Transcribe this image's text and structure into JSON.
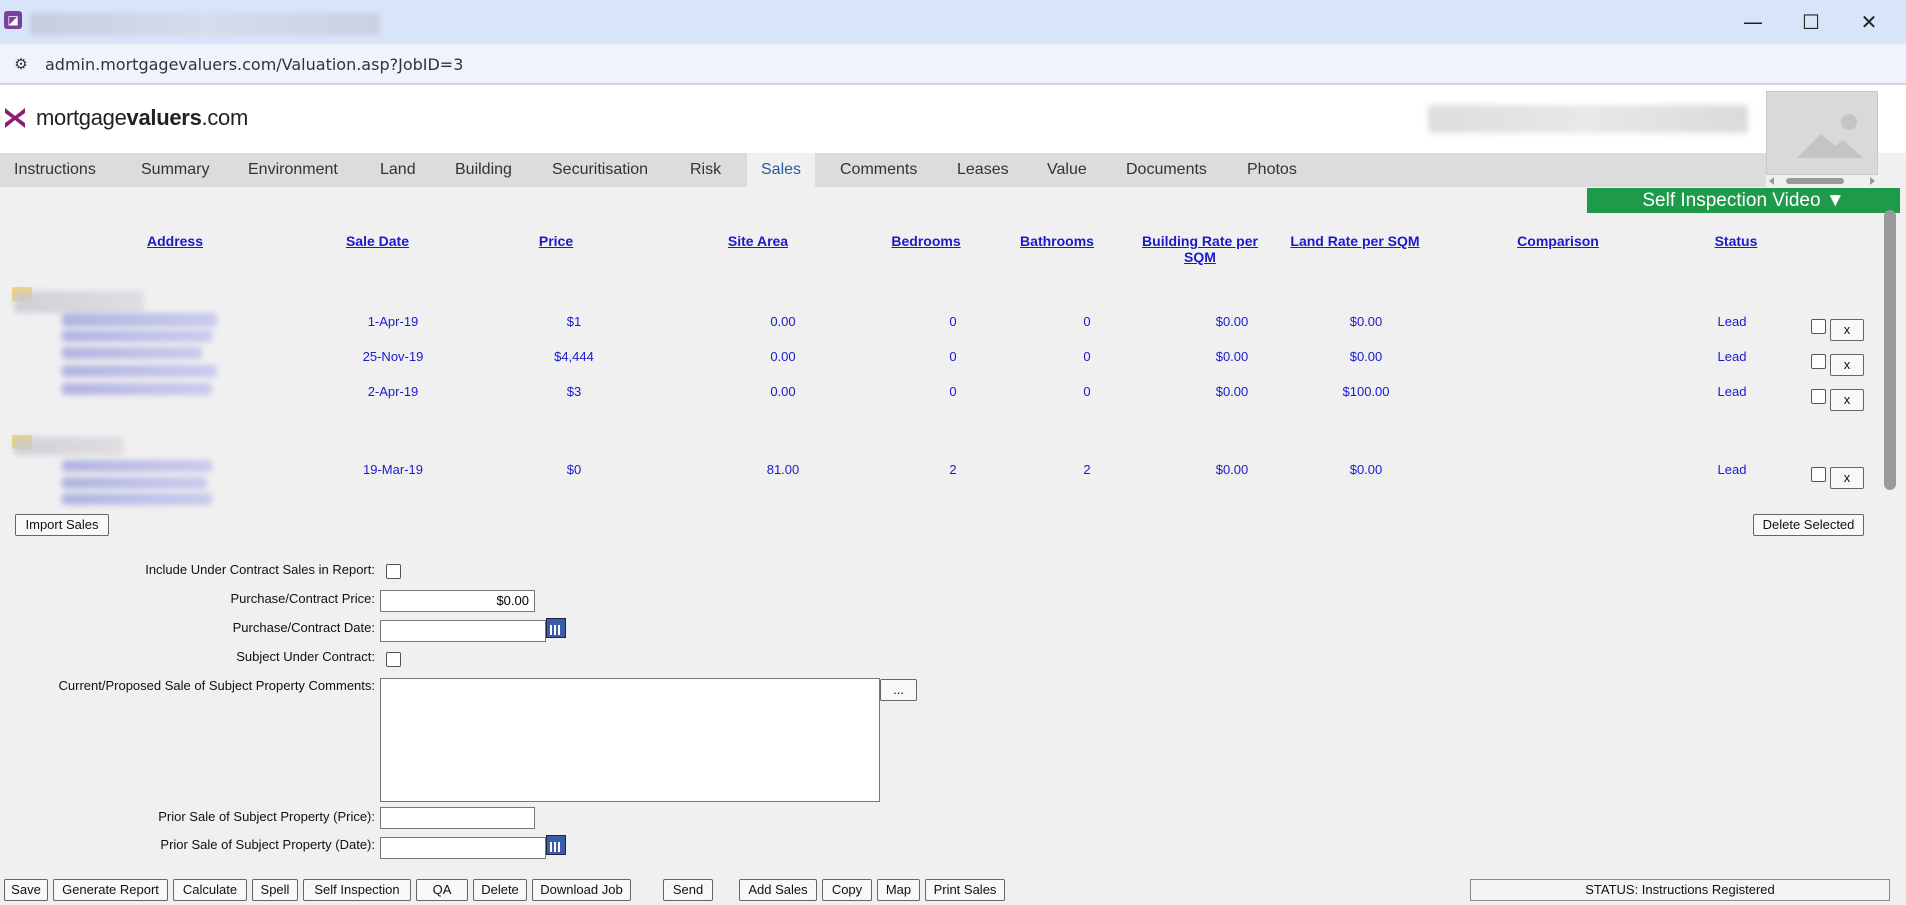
{
  "browser": {
    "url": "admin.mortgagevaluers.com/Valuation.asp?JobID=3",
    "minimize": "—",
    "maximize": "☐",
    "close": "✕"
  },
  "logo": {
    "text_plain": "mortgage",
    "text_bold": "valuers",
    "text_suffix": ".com"
  },
  "tabs": [
    {
      "label": "Instructions"
    },
    {
      "label": "Summary"
    },
    {
      "label": "Environment"
    },
    {
      "label": "Land"
    },
    {
      "label": "Building"
    },
    {
      "label": "Securitisation"
    },
    {
      "label": "Risk"
    },
    {
      "label": "Sales",
      "active": true
    },
    {
      "label": "Comments"
    },
    {
      "label": "Leases"
    },
    {
      "label": "Value"
    },
    {
      "label": "Documents"
    },
    {
      "label": "Photos"
    }
  ],
  "video_button": "Self Inspection Video ▼",
  "columns": {
    "address": "Address",
    "sale_date": "Sale Date",
    "price": "Price",
    "site_area": "Site Area",
    "bedrooms": "Bedrooms",
    "bathrooms": "Bathrooms",
    "building_rate": "Building Rate per SQM",
    "land_rate": "Land Rate per SQM",
    "comparison": "Comparison",
    "status": "Status"
  },
  "sales": [
    {
      "sale_date": "1-Apr-19",
      "price": "$1",
      "site_area": "0.00",
      "bedrooms": "0",
      "bathrooms": "0",
      "building_rate": "$0.00",
      "land_rate": "$0.00",
      "status": "Lead"
    },
    {
      "sale_date": "25-Nov-19",
      "price": "$4,444",
      "site_area": "0.00",
      "bedrooms": "0",
      "bathrooms": "0",
      "building_rate": "$0.00",
      "land_rate": "$0.00",
      "status": "Lead"
    },
    {
      "sale_date": "2-Apr-19",
      "price": "$3",
      "site_area": "0.00",
      "bedrooms": "0",
      "bathrooms": "0",
      "building_rate": "$0.00",
      "land_rate": "$100.00",
      "status": "Lead"
    },
    {
      "sale_date": "19-Mar-19",
      "price": "$0",
      "site_area": "81.00",
      "bedrooms": "2",
      "bathrooms": "2",
      "building_rate": "$0.00",
      "land_rate": "$0.00",
      "status": "Lead"
    }
  ],
  "row_delete_label": "x",
  "import_sales": "Import Sales",
  "delete_selected": "Delete Selected",
  "form": {
    "include_under_contract": "Include Under Contract Sales in Report:",
    "purchase_price_label": "Purchase/Contract Price:",
    "purchase_price_value": "$0.00",
    "purchase_date_label": "Purchase/Contract Date:",
    "subject_under_contract": "Subject Under Contract:",
    "comments_label": "Current/Proposed Sale of Subject Property Comments:",
    "ellipsis": "...",
    "prior_price_label": "Prior Sale of Subject Property (Price):",
    "prior_date_label": "Prior Sale of Subject Property (Date):"
  },
  "bottom_buttons": [
    "Save",
    "Generate Report",
    "Calculate",
    "Spell",
    "Self Inspection",
    "QA",
    "Delete",
    "Download Job",
    "Send",
    "Add Sales",
    "Copy",
    "Map",
    "Print Sales"
  ],
  "status": "STATUS: Instructions Registered"
}
